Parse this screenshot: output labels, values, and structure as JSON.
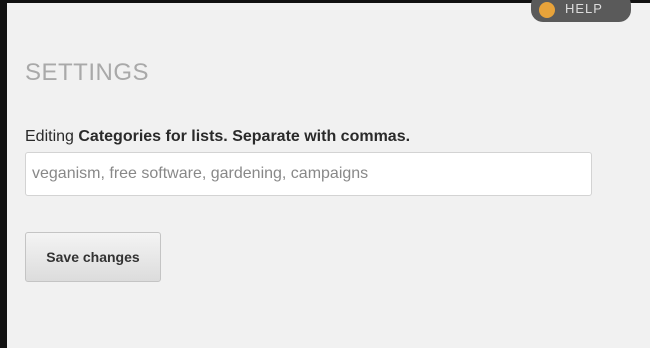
{
  "header": {
    "help_label": "HELP"
  },
  "page": {
    "title": "SETTINGS"
  },
  "form": {
    "editing_prefix": "Editing",
    "field_name": "Categories for lists. Separate with commas.",
    "categories_value": "veganism, free software, gardening, campaigns",
    "save_label": "Save changes"
  },
  "icons": {
    "help": "help-icon"
  },
  "colors": {
    "background": "#f1f1f1",
    "title": "#a9a9a9",
    "help_pill": "#5a5a5a",
    "help_icon": "#e8a33a"
  }
}
